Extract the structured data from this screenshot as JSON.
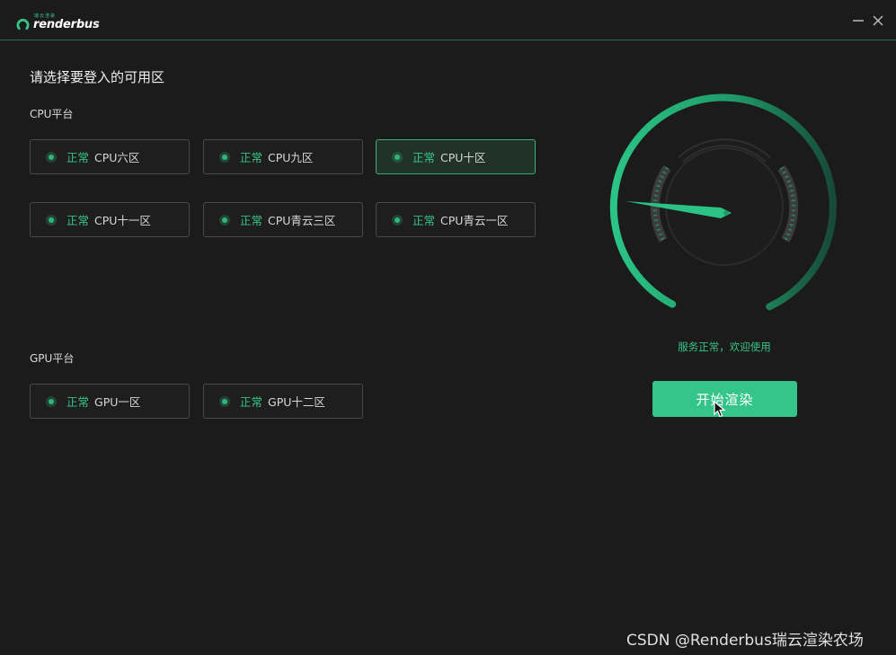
{
  "app": {
    "logo_small": "瑞云渲染",
    "logo_text": "renderbus",
    "accent_color": "#35c48a"
  },
  "window_controls": {
    "minimize_icon": "minimize-icon",
    "close_icon": "close-icon"
  },
  "main": {
    "heading": "请选择要登入的可用区",
    "cpu_section": {
      "label": "CPU平台",
      "zones": [
        {
          "status": "正常",
          "name": "CPU六区",
          "selected": false
        },
        {
          "status": "正常",
          "name": "CPU九区",
          "selected": false
        },
        {
          "status": "正常",
          "name": "CPU十区",
          "selected": true
        },
        {
          "status": "正常",
          "name": "CPU十一区",
          "selected": false
        },
        {
          "status": "正常",
          "name": "CPU青云三区",
          "selected": false
        },
        {
          "status": "正常",
          "name": "CPU青云一区",
          "selected": false
        }
      ]
    },
    "gpu_section": {
      "label": "GPU平台",
      "zones": [
        {
          "status": "正常",
          "name": "GPU一区",
          "selected": false
        },
        {
          "status": "正常",
          "name": "GPU十二区",
          "selected": false
        }
      ]
    }
  },
  "gauge": {
    "icon": "speedometer-gauge-icon"
  },
  "service_status": "服务正常，欢迎使用",
  "start_button_label": "开始渲染",
  "watermark": "CSDN @Renderbus瑞云渲染农场"
}
